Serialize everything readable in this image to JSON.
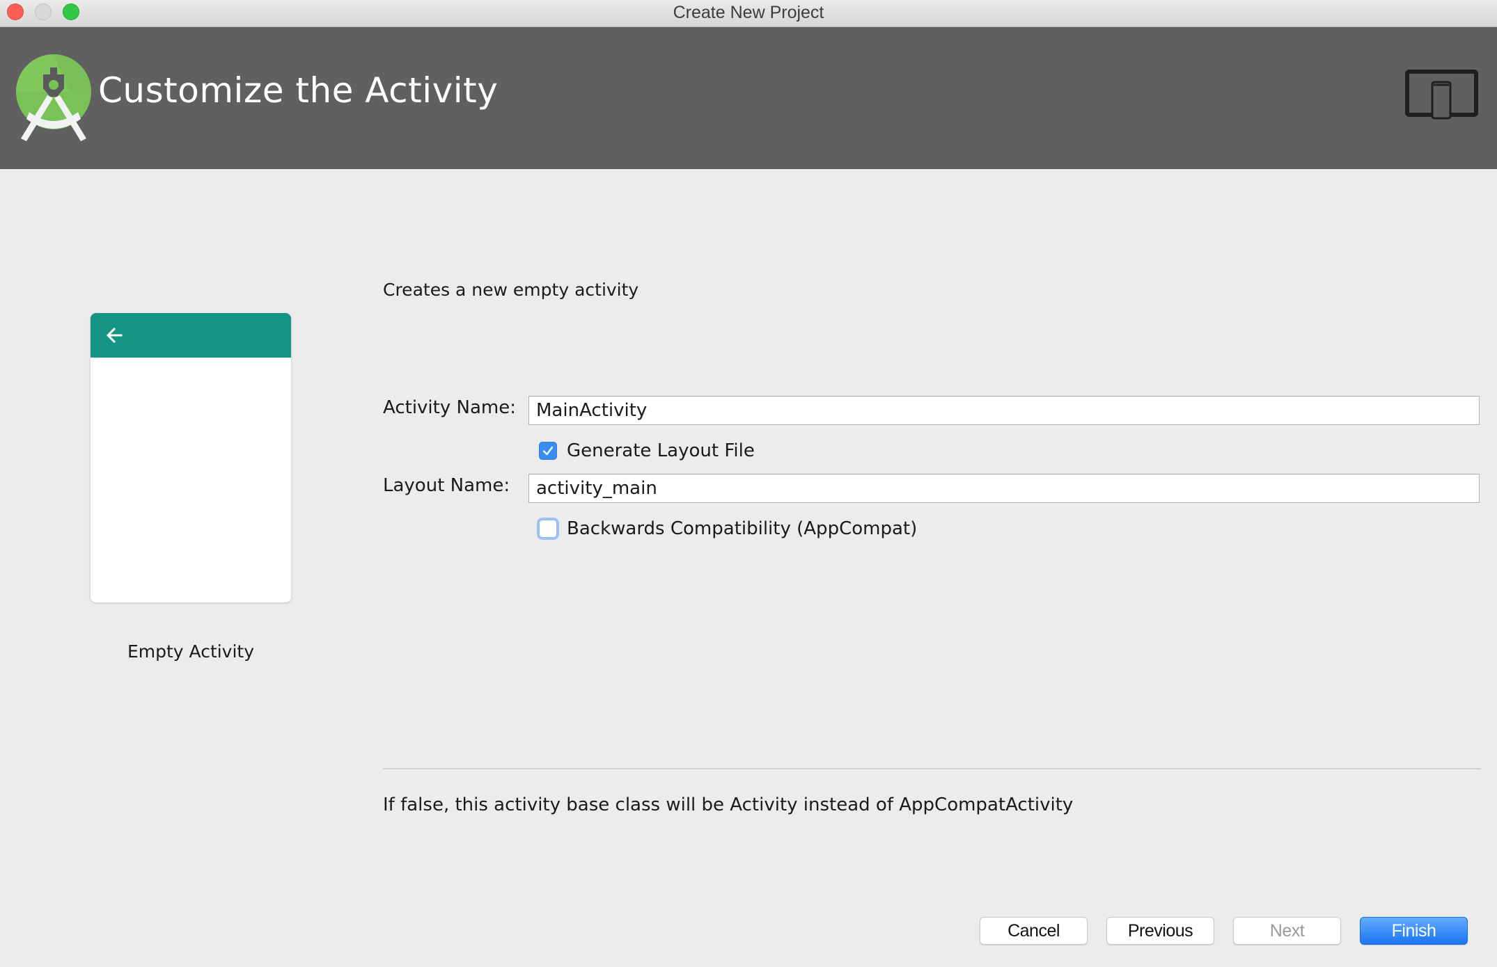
{
  "window": {
    "title": "Create New Project",
    "controls": [
      "close",
      "minimize",
      "maximize"
    ]
  },
  "header": {
    "title": "Customize the Activity",
    "logo_icon": "android-studio-logo-icon",
    "device_icon": "tablet-phone-icon",
    "background_color": "#606060"
  },
  "preview": {
    "toolbar_color": "#159383",
    "toolbar_icon": "back-arrow-icon",
    "label": "Empty Activity"
  },
  "form": {
    "description": "Creates a new empty activity",
    "activity_name": {
      "label": "Activity Name:",
      "value": "MainActivity"
    },
    "generate_layout": {
      "label": "Generate Layout File",
      "checked": true
    },
    "layout_name": {
      "label": "Layout Name:",
      "value": "activity_main"
    },
    "backwards_compat": {
      "label": "Backwards Compatibility (AppCompat)",
      "checked": false,
      "focused": true
    },
    "hint": "If false, this activity base class will be Activity instead of AppCompatActivity"
  },
  "buttons": {
    "cancel": "Cancel",
    "previous": "Previous",
    "next": "Next",
    "finish": "Finish",
    "next_disabled": true,
    "primary_color": "#1b74f0"
  },
  "colors": {
    "checkbox_accent": "#3a8cf0",
    "background": "#ececec"
  }
}
